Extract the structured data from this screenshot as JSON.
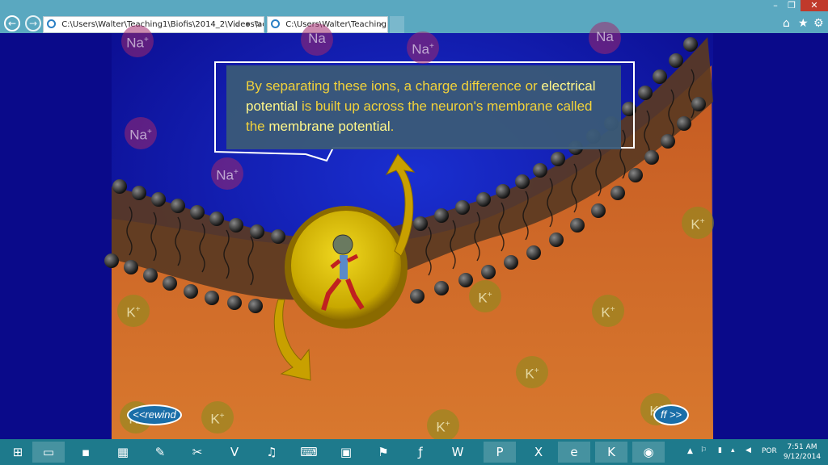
{
  "browser": {
    "tabs": [
      {
        "address": "C:\\Users\\Walter\\Teaching1\\Biofis\\2014_2\\Videos\\actic"
      },
      {
        "title": "C:\\Users\\Walter\\Teaching1...",
        "close": "×"
      }
    ],
    "search_glyph": "⌕",
    "dropdown_glyph": "▾",
    "refresh_glyph": "↻",
    "back_glyph": "←",
    "forward_glyph": "→",
    "window_controls": {
      "minimize": "–",
      "maximize": "❐",
      "close": "✕"
    },
    "toolbar_icons": [
      "home-icon",
      "star-icon",
      "gear-icon"
    ]
  },
  "animation": {
    "callout": {
      "part1": "By separating these ions, a charge difference or ",
      "highlight1": "electrical potential",
      "part2": " is built up across the neuron's membrane called the ",
      "highlight2": "membrane potential",
      "part3": "."
    },
    "ion_labels": {
      "na": "Na",
      "k": "K",
      "charge": "+"
    },
    "rewind_label": "<<rewind",
    "ff_label": "ff >>",
    "colors": {
      "outside": "#0a0a8a",
      "inside": "#d06a2a",
      "callout_text": "#f2d23a",
      "highlight": "#fff78a"
    }
  },
  "taskbar": {
    "apps": [
      "start",
      "file-explorer",
      "cmd",
      "calculator",
      "paint",
      "snipping",
      "vim",
      "itunes",
      "typing",
      "vmd",
      "acrobat",
      "flash",
      "word",
      "powerpoint",
      "excel",
      "internet-explorer",
      "kaspersky",
      "app-globe"
    ],
    "language": "POR",
    "time": "7:51 AM",
    "date": "9/12/2014"
  }
}
